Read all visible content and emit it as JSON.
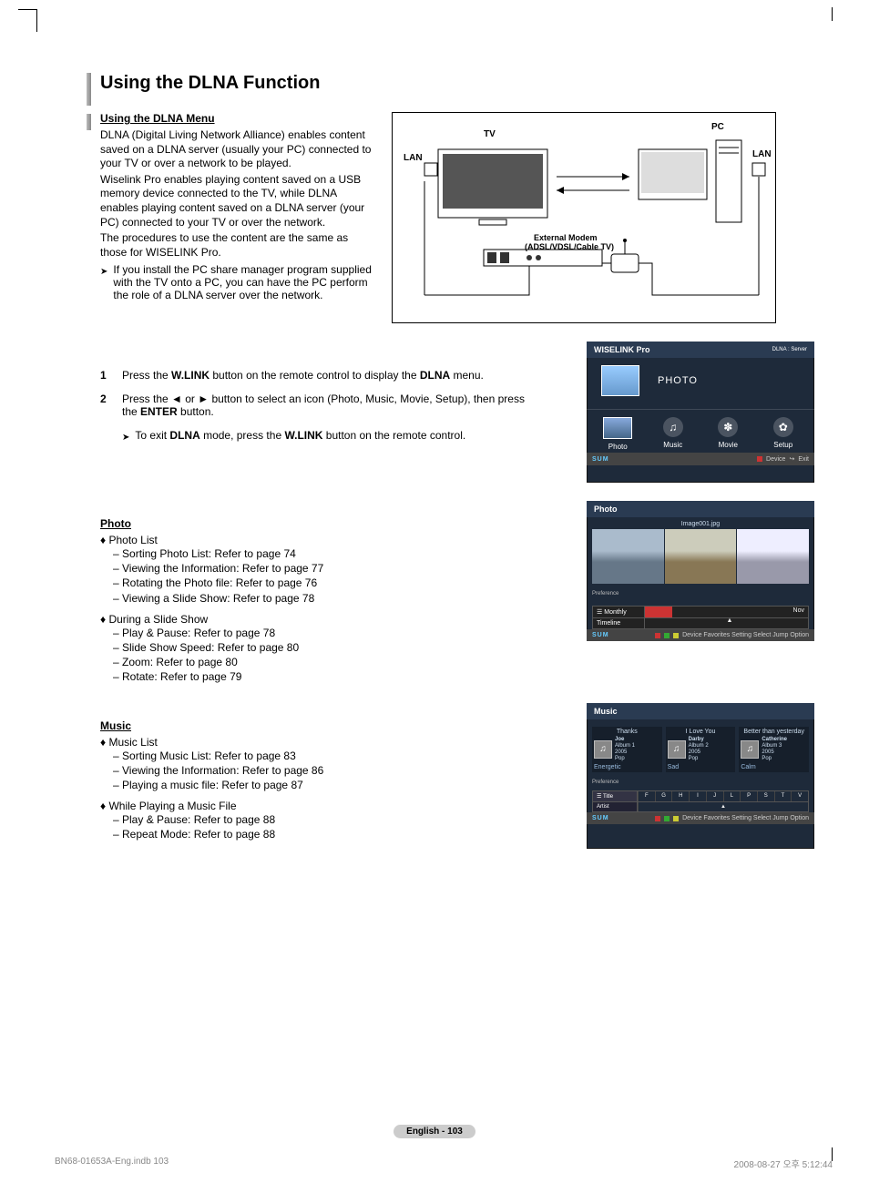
{
  "title": "Using the DLNA Function",
  "menuHeading": "Using the DLNA Menu",
  "intro": {
    "p1": "DLNA (Digital Living Network Alliance) enables content saved on a DLNA server (usually your PC) connected to your TV or over a network to be played.",
    "p2": "Wiselink Pro enables playing content saved on a USB memory device connected to the TV, while DLNA enables playing content saved on a DLNA server (your PC) connected to your TV or over the network.",
    "p3": "The procedures to use the content are the same as those for WISELINK Pro.",
    "note": "If you install the PC share manager program supplied with the TV onto a PC, you can have the PC perform the role of a DLNA server over the network."
  },
  "diagram": {
    "tv": "TV",
    "pc": "PC",
    "lan": "LAN",
    "modem1": "External Modem",
    "modem2": "(ADSL/VDSL/Cable TV)"
  },
  "steps": {
    "s1n": "1",
    "s1a": "Press the ",
    "s1b": "W.LINK",
    "s1c": " button on the remote control to display the ",
    "s1d": "DLNA",
    "s1e": " menu.",
    "s2n": "2",
    "s2a": "Press the ◄ or ► button to select an icon (Photo, Music, Movie, Setup), then press the ",
    "s2b": "ENTER",
    "s2c": " button.",
    "s2noteA": "To exit ",
    "s2noteB": "DLNA",
    "s2noteC": " mode, press the ",
    "s2noteD": "W.LINK",
    "s2noteE": " button on the remote control."
  },
  "wiselink": {
    "title": "WISELINK Pro",
    "server": "DLNA : Server",
    "hero": "PHOTO",
    "items": [
      "Photo",
      "Music",
      "Movie",
      "Setup"
    ],
    "sum": "SUM",
    "device": "Device",
    "exit": "Exit"
  },
  "photoSection": {
    "heading": "Photo",
    "list1h": "Photo List",
    "list1": [
      "Sorting Photo List: Refer to page 74",
      "Viewing the Information: Refer to page 77",
      "Rotating the Photo file: Refer to page 76",
      "Viewing a Slide Show: Refer to page 78"
    ],
    "list2h": "During a Slide Show",
    "list2": [
      "Play & Pause: Refer to page 78",
      "Slide Show Speed: Refer to page 80",
      "Zoom: Refer to page 80",
      "Rotate: Refer to page 79"
    ]
  },
  "photoScreen": {
    "title": "Photo",
    "filename": "Image001.jpg",
    "pref": "Preference",
    "sort": "Monthly",
    "timeline": "Timeline",
    "nov": "Nov",
    "sum": "SUM",
    "foot": "Device    Favorites Setting    Select    Jump    Option"
  },
  "musicSection": {
    "heading": "Music",
    "list1h": "Music List",
    "list1": [
      "Sorting Music List: Refer to page 83",
      "Viewing the Information: Refer to page 86",
      "Playing a music file: Refer to page 87"
    ],
    "list2h": "While Playing a Music File",
    "list2": [
      "Play & Pause: Refer to page 88",
      "Repeat Mode: Refer to page 88"
    ]
  },
  "musicScreen": {
    "title": "Music",
    "cards": [
      {
        "t": "Thanks",
        "name": "Joe",
        "l1": "Album 1",
        "l2": "2005",
        "l3": "Pop",
        "mood": "Energetic"
      },
      {
        "t": "I Love You",
        "name": "Darby",
        "l1": "Album 2",
        "l2": "2005",
        "l3": "Pop",
        "mood": "Sad"
      },
      {
        "t": "Better than yesterday",
        "name": "Catherine",
        "l1": "Album 3",
        "l2": "2005",
        "l3": "Pop",
        "mood": "Calm"
      }
    ],
    "pref": "Preference",
    "titleSort": "Title",
    "artist": "Artist",
    "alpha": [
      "F",
      "G",
      "H",
      "I",
      "J",
      "L",
      "P",
      "S",
      "T",
      "V"
    ],
    "sum": "SUM",
    "foot": "Device    Favorites Setting    Select    Jump    Option"
  },
  "pageBadge": "English - 103",
  "footer": {
    "left": "BN68-01653A-Eng.indb   103",
    "right": "2008-08-27   오후 5:12:44"
  }
}
